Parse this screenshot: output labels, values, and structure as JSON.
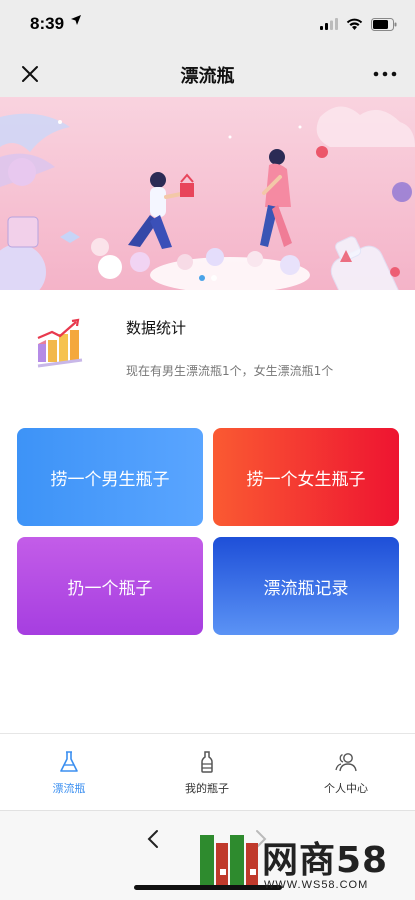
{
  "status_bar": {
    "time": "8:39",
    "location_icon": "location-arrow-icon"
  },
  "nav": {
    "title": "漂流瓶",
    "close_icon": "close-icon",
    "more_icon": "more-icon"
  },
  "banner": {
    "slides": 2,
    "active_slide": 1
  },
  "stats": {
    "title": "数据统计",
    "description": "现在有男生漂流瓶1个，女生漂流瓶1个",
    "icon": "bar-chart-icon"
  },
  "actions": {
    "fish_boy": "捞一个男生瓶子",
    "fish_girl": "捞一个女生瓶子",
    "throw": "扔一个瓶子",
    "record": "漂流瓶记录"
  },
  "colors": {
    "fish_boy": "#3d93f7",
    "fish_girl": "#ee1431",
    "throw": "#b04be4",
    "record": "#2a5fe0",
    "tab_active": "#3b8ff0"
  },
  "tabs": [
    {
      "label": "漂流瓶",
      "icon": "flask-icon",
      "active": true
    },
    {
      "label": "我的瓶子",
      "icon": "bottle-icon",
      "active": false
    },
    {
      "label": "个人中心",
      "icon": "user-group-icon",
      "active": false
    }
  ],
  "watermark": {
    "text": "网商58",
    "url": "WWW.WS58.COM"
  }
}
